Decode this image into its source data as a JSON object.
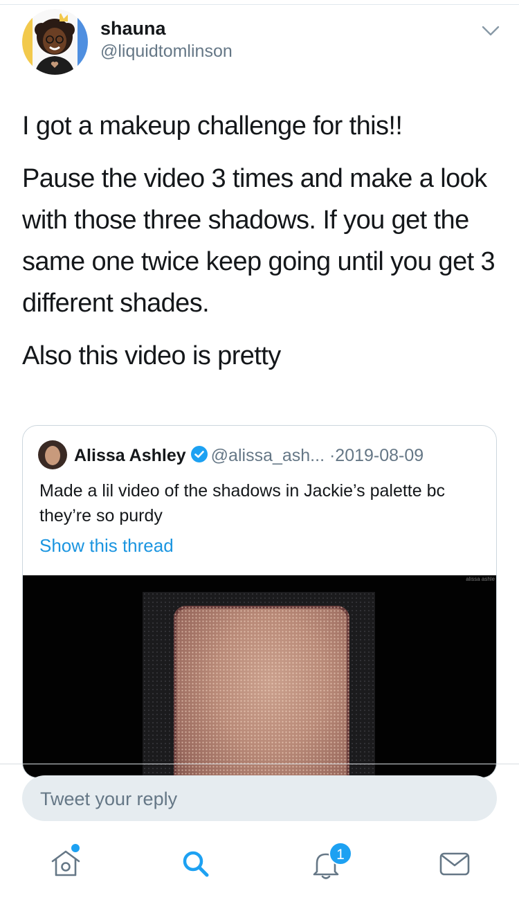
{
  "tweet": {
    "author": {
      "display_name": "shauna",
      "handle": "@liquidtomlinson"
    },
    "paragraphs": [
      "I got a makeup challenge for this!!",
      "Pause the video 3 times and make a look with those three shadows. If you get the same one twice keep going until you get 3 different shades.",
      "Also this video is pretty"
    ]
  },
  "quoted_tweet": {
    "display_name": "Alissa Ashley",
    "handle": "@alissa_ash...",
    "separator": "·",
    "date": "2019-08-09",
    "text": "Made a lil video of the shadows in Jackie’s palette bc they’re so purdy",
    "thread_link": "Show this thread",
    "media_watermark": "alissa ashle"
  },
  "reply": {
    "placeholder": "Tweet your reply"
  },
  "tab_bar": {
    "notifications_badge": "1"
  },
  "colors": {
    "link": "#1b95e0",
    "accent": "#1da1f2",
    "secondary_text": "#657786"
  }
}
